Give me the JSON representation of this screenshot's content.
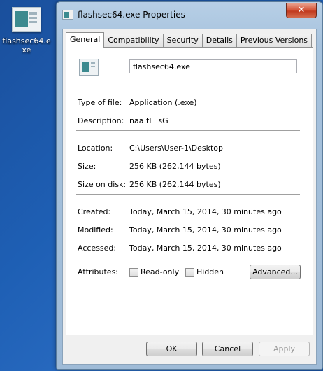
{
  "desktop": {
    "icon_label": "flashsec64.exe"
  },
  "window": {
    "title": "flashsec64.exe Properties",
    "close_glyph": "✕"
  },
  "tabs": [
    {
      "label": "General"
    },
    {
      "label": "Compatibility"
    },
    {
      "label": "Security"
    },
    {
      "label": "Details"
    },
    {
      "label": "Previous Versions"
    }
  ],
  "general": {
    "file_name": "flashsec64.exe",
    "type_label": "Type of file:",
    "type_value": "Application (.exe)",
    "description_label": "Description:",
    "description_value": "naa tL  sG",
    "location_label": "Location:",
    "location_value": "C:\\Users\\User-1\\Desktop",
    "size_label": "Size:",
    "size_value": "256 KB (262,144 bytes)",
    "size_on_disk_label": "Size on disk:",
    "size_on_disk_value": "256 KB (262,144 bytes)",
    "created_label": "Created:",
    "created_value": "Today, March 15, 2014, 30 minutes ago",
    "modified_label": "Modified:",
    "modified_value": "Today, March 15, 2014, 30 minutes ago",
    "accessed_label": "Accessed:",
    "accessed_value": "Today, March 15, 2014, 30 minutes ago",
    "attributes_label": "Attributes:",
    "readonly_label": "Read-only",
    "hidden_label": "Hidden",
    "advanced_label": "Advanced..."
  },
  "footer": {
    "ok_label": "OK",
    "cancel_label": "Cancel",
    "apply_label": "Apply"
  }
}
